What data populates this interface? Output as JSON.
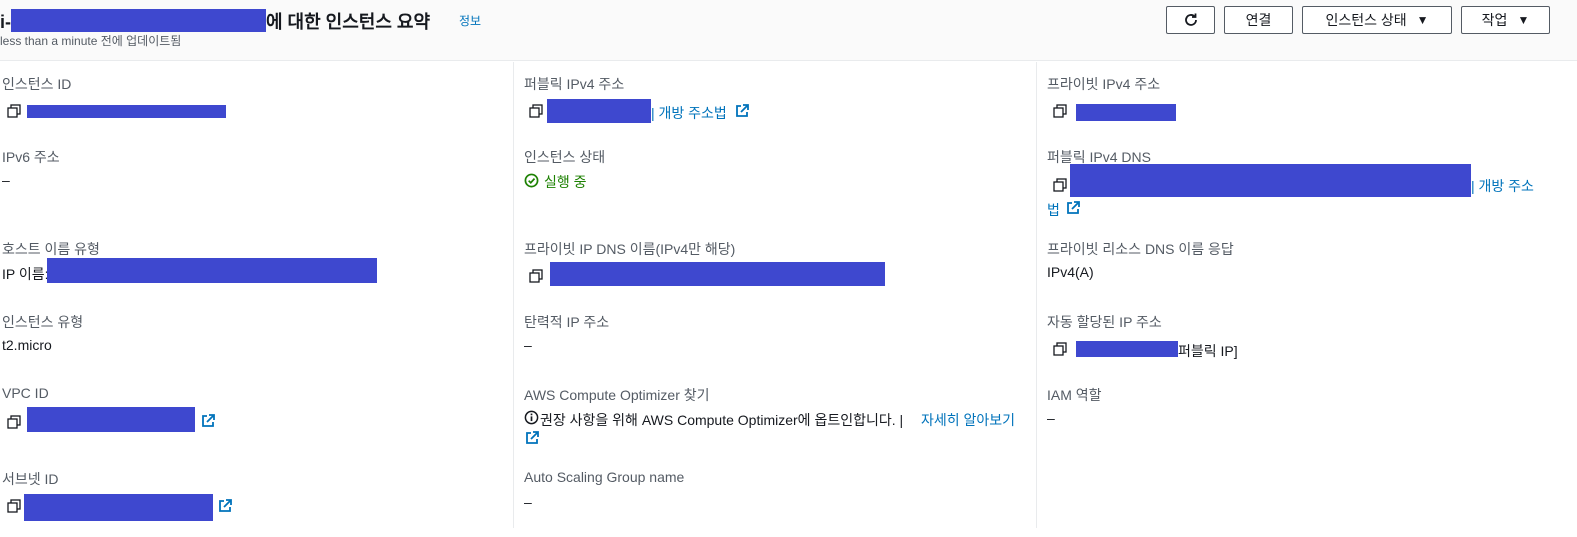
{
  "header": {
    "title_prefix": "i-",
    "title_suffix": "에 대한 인스턴스 요약",
    "info_label": "정보",
    "updated": "less than a minute 전에 업데이트됨",
    "buttons": {
      "connect": "연결",
      "instance_state": "인스턴스 상태",
      "actions": "작업"
    }
  },
  "fields": {
    "instance_id_label": "인스턴스 ID",
    "ipv6_label": "IPv6 주소",
    "ipv6_value": "–",
    "hostname_type_label": "호스트 이름 유형",
    "hostname_type_value": "IP 이름:",
    "instance_type_label": "인스턴스 유형",
    "instance_type_value": "t2.micro",
    "vpc_id_label": "VPC ID",
    "subnet_id_label": "서브넷 ID",
    "public_ipv4_label": "퍼블릭 IPv4 주소",
    "public_ipv4_link": "| 개방 주소법",
    "instance_state_label": "인스턴스 상태",
    "instance_state_value": "실행 중",
    "private_ip_dns_label": "프라이빗 IP DNS 이름(IPv4만 해당)",
    "elastic_ip_label": "탄력적 IP 주소",
    "elastic_ip_value": "–",
    "compute_optimizer_label": "AWS Compute Optimizer 찾기",
    "compute_optimizer_text": "권장 사항을 위해 AWS Compute Optimizer에 옵트인합니다. |",
    "compute_optimizer_link": "자세히 알아보기",
    "asg_label": "Auto Scaling Group name",
    "asg_value": "–",
    "private_ipv4_label": "프라이빗 IPv4 주소",
    "public_dns_label": "퍼블릭 IPv4 DNS",
    "public_dns_link_1": "| 개방 주소",
    "public_dns_link_2": "법",
    "private_resource_dns_label": "프라이빗 리소스 DNS 이름 응답",
    "private_resource_dns_value": "IPv4(A)",
    "auto_ip_label": "자동 할당된 IP 주소",
    "auto_ip_suffix": "퍼블릭 IP]",
    "iam_role_label": "IAM 역할",
    "iam_role_value": "–"
  },
  "colors": {
    "link": "#0073bb",
    "running": "#1d8102",
    "redaction": "#3e48cf"
  },
  "icons": [
    "refresh-icon",
    "caret-down-icon",
    "copy-icon",
    "external-link-icon",
    "check-circle-icon",
    "info-icon"
  ]
}
